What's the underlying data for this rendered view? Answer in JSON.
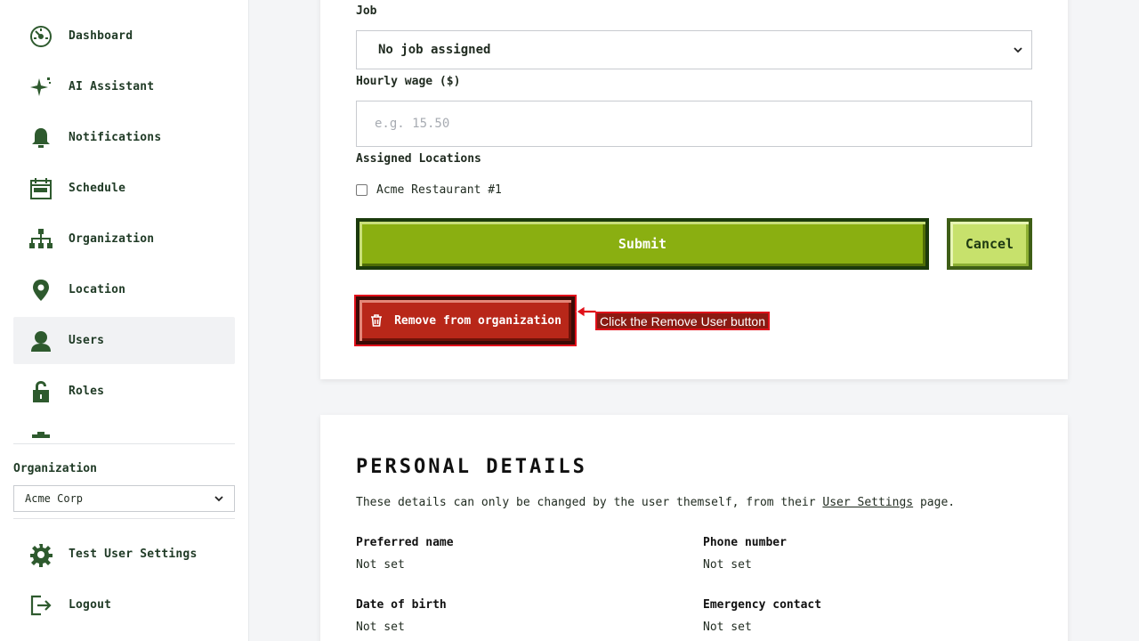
{
  "sidebar": {
    "items": [
      {
        "label": "Dashboard",
        "icon": "dashboard-icon"
      },
      {
        "label": "AI Assistant",
        "icon": "sparkle-icon"
      },
      {
        "label": "Notifications",
        "icon": "bell-icon"
      },
      {
        "label": "Schedule",
        "icon": "calendar-icon"
      },
      {
        "label": "Organization",
        "icon": "org-chart-icon"
      },
      {
        "label": "Location",
        "icon": "location-pin-icon"
      },
      {
        "label": "Users",
        "icon": "user-icon",
        "active": true
      },
      {
        "label": "Roles",
        "icon": "unlock-icon"
      }
    ],
    "organization_label": "Organization",
    "organization_selected": "Acme Corp",
    "bottom_items": [
      {
        "label": "Test User Settings",
        "icon": "gear-icon"
      },
      {
        "label": "Logout",
        "icon": "logout-icon"
      }
    ]
  },
  "form": {
    "job_label": "Job",
    "job_selected": "No job assigned",
    "wage_label": "Hourly wage ($)",
    "wage_placeholder": "e.g. 15.50",
    "locations_label": "Assigned Locations",
    "locations": [
      {
        "label": "Acme Restaurant #1",
        "checked": false
      }
    ],
    "submit_label": "Submit",
    "cancel_label": "Cancel",
    "remove_label": "Remove from organization"
  },
  "hint": {
    "text": "Click the Remove User button"
  },
  "personal": {
    "title": "PERSONAL DETAILS",
    "desc_before": "These details can only be changed by the user themself, from their ",
    "desc_link": "User Settings",
    "desc_after": " page.",
    "fields": {
      "preferred_name": {
        "label": "Preferred name",
        "value": "Not set"
      },
      "phone": {
        "label": "Phone number",
        "value": "Not set"
      },
      "dob": {
        "label": "Date of birth",
        "value": "Not set"
      },
      "emergency": {
        "label": "Emergency contact",
        "value": "Not set"
      }
    }
  },
  "colors": {
    "brand_dark": "#1f3a25",
    "submit_green": "#8aaf11",
    "cancel_green": "#c7e16c",
    "danger_red": "#b82719",
    "highlight_red": "#e0101a"
  }
}
